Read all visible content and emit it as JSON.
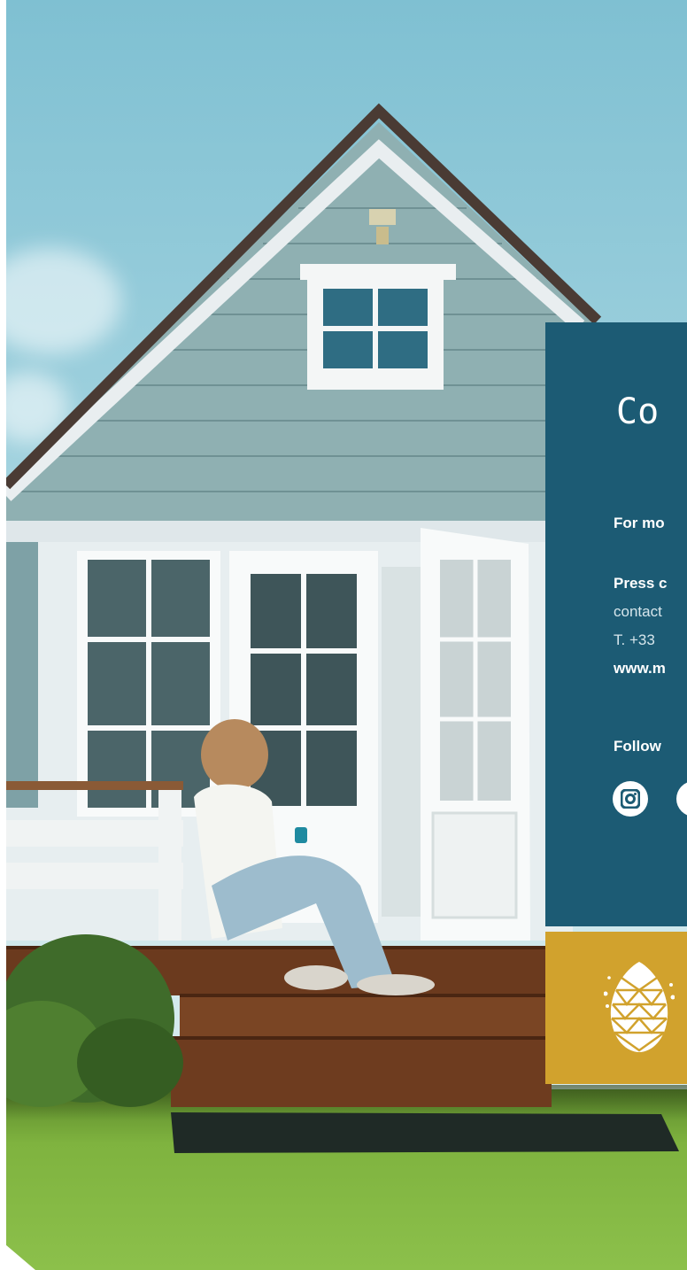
{
  "contact": {
    "title": "Co",
    "more_info": "For mo",
    "press_label": "Press c",
    "email": "contact",
    "phone": "T. +33 ",
    "website": "www.m",
    "follow_label": "Follow"
  },
  "social": {
    "icons": [
      "instagram-icon",
      "social-icon"
    ]
  },
  "badge": {
    "icon": "pinecone-icon"
  },
  "colors": {
    "panel": "#1c5b74",
    "badge": "#d1a22d"
  }
}
